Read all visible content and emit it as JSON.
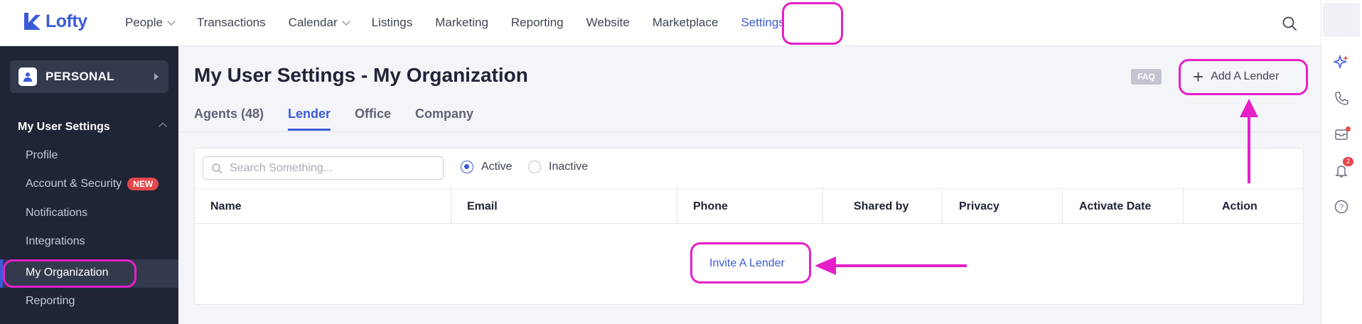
{
  "app": {
    "logo_text": "Lofty"
  },
  "nav": {
    "items": [
      {
        "label": "People",
        "has_dropdown": true
      },
      {
        "label": "Transactions",
        "has_dropdown": false
      },
      {
        "label": "Calendar",
        "has_dropdown": true
      },
      {
        "label": "Listings",
        "has_dropdown": false
      },
      {
        "label": "Marketing",
        "has_dropdown": false
      },
      {
        "label": "Reporting",
        "has_dropdown": false
      },
      {
        "label": "Website",
        "has_dropdown": false
      },
      {
        "label": "Marketplace",
        "has_dropdown": false
      },
      {
        "label": "Settings",
        "has_dropdown": false,
        "active": true
      }
    ]
  },
  "rail": {
    "notification_count": "2"
  },
  "sidebar": {
    "account_label": "PERSONAL",
    "section_title": "My User Settings",
    "items": [
      {
        "label": "Profile"
      },
      {
        "label": "Account & Security",
        "badge": "NEW"
      },
      {
        "label": "Notifications"
      },
      {
        "label": "Integrations"
      },
      {
        "label": "My Organization",
        "active": true
      },
      {
        "label": "Reporting"
      }
    ]
  },
  "main": {
    "title": "My User Settings - My Organization",
    "faq_label": "FAQ",
    "add_button_label": "Add A Lender",
    "tabs": [
      {
        "label": "Agents (48)"
      },
      {
        "label": "Lender",
        "active": true
      },
      {
        "label": "Office"
      },
      {
        "label": "Company"
      }
    ],
    "search_placeholder": "Search Something...",
    "filter": {
      "active_label": "Active",
      "inactive_label": "Inactive",
      "selected": "Active"
    },
    "table": {
      "columns": [
        "Name",
        "Email",
        "Phone",
        "Shared by",
        "Privacy",
        "Activate Date",
        "Action"
      ]
    },
    "empty_link": "Invite A Lender"
  },
  "colors": {
    "accent": "#3b5bd9",
    "sidebar_bg": "#1f2437",
    "annotation": "#e61fc8",
    "badge_red": "#e5484d"
  }
}
